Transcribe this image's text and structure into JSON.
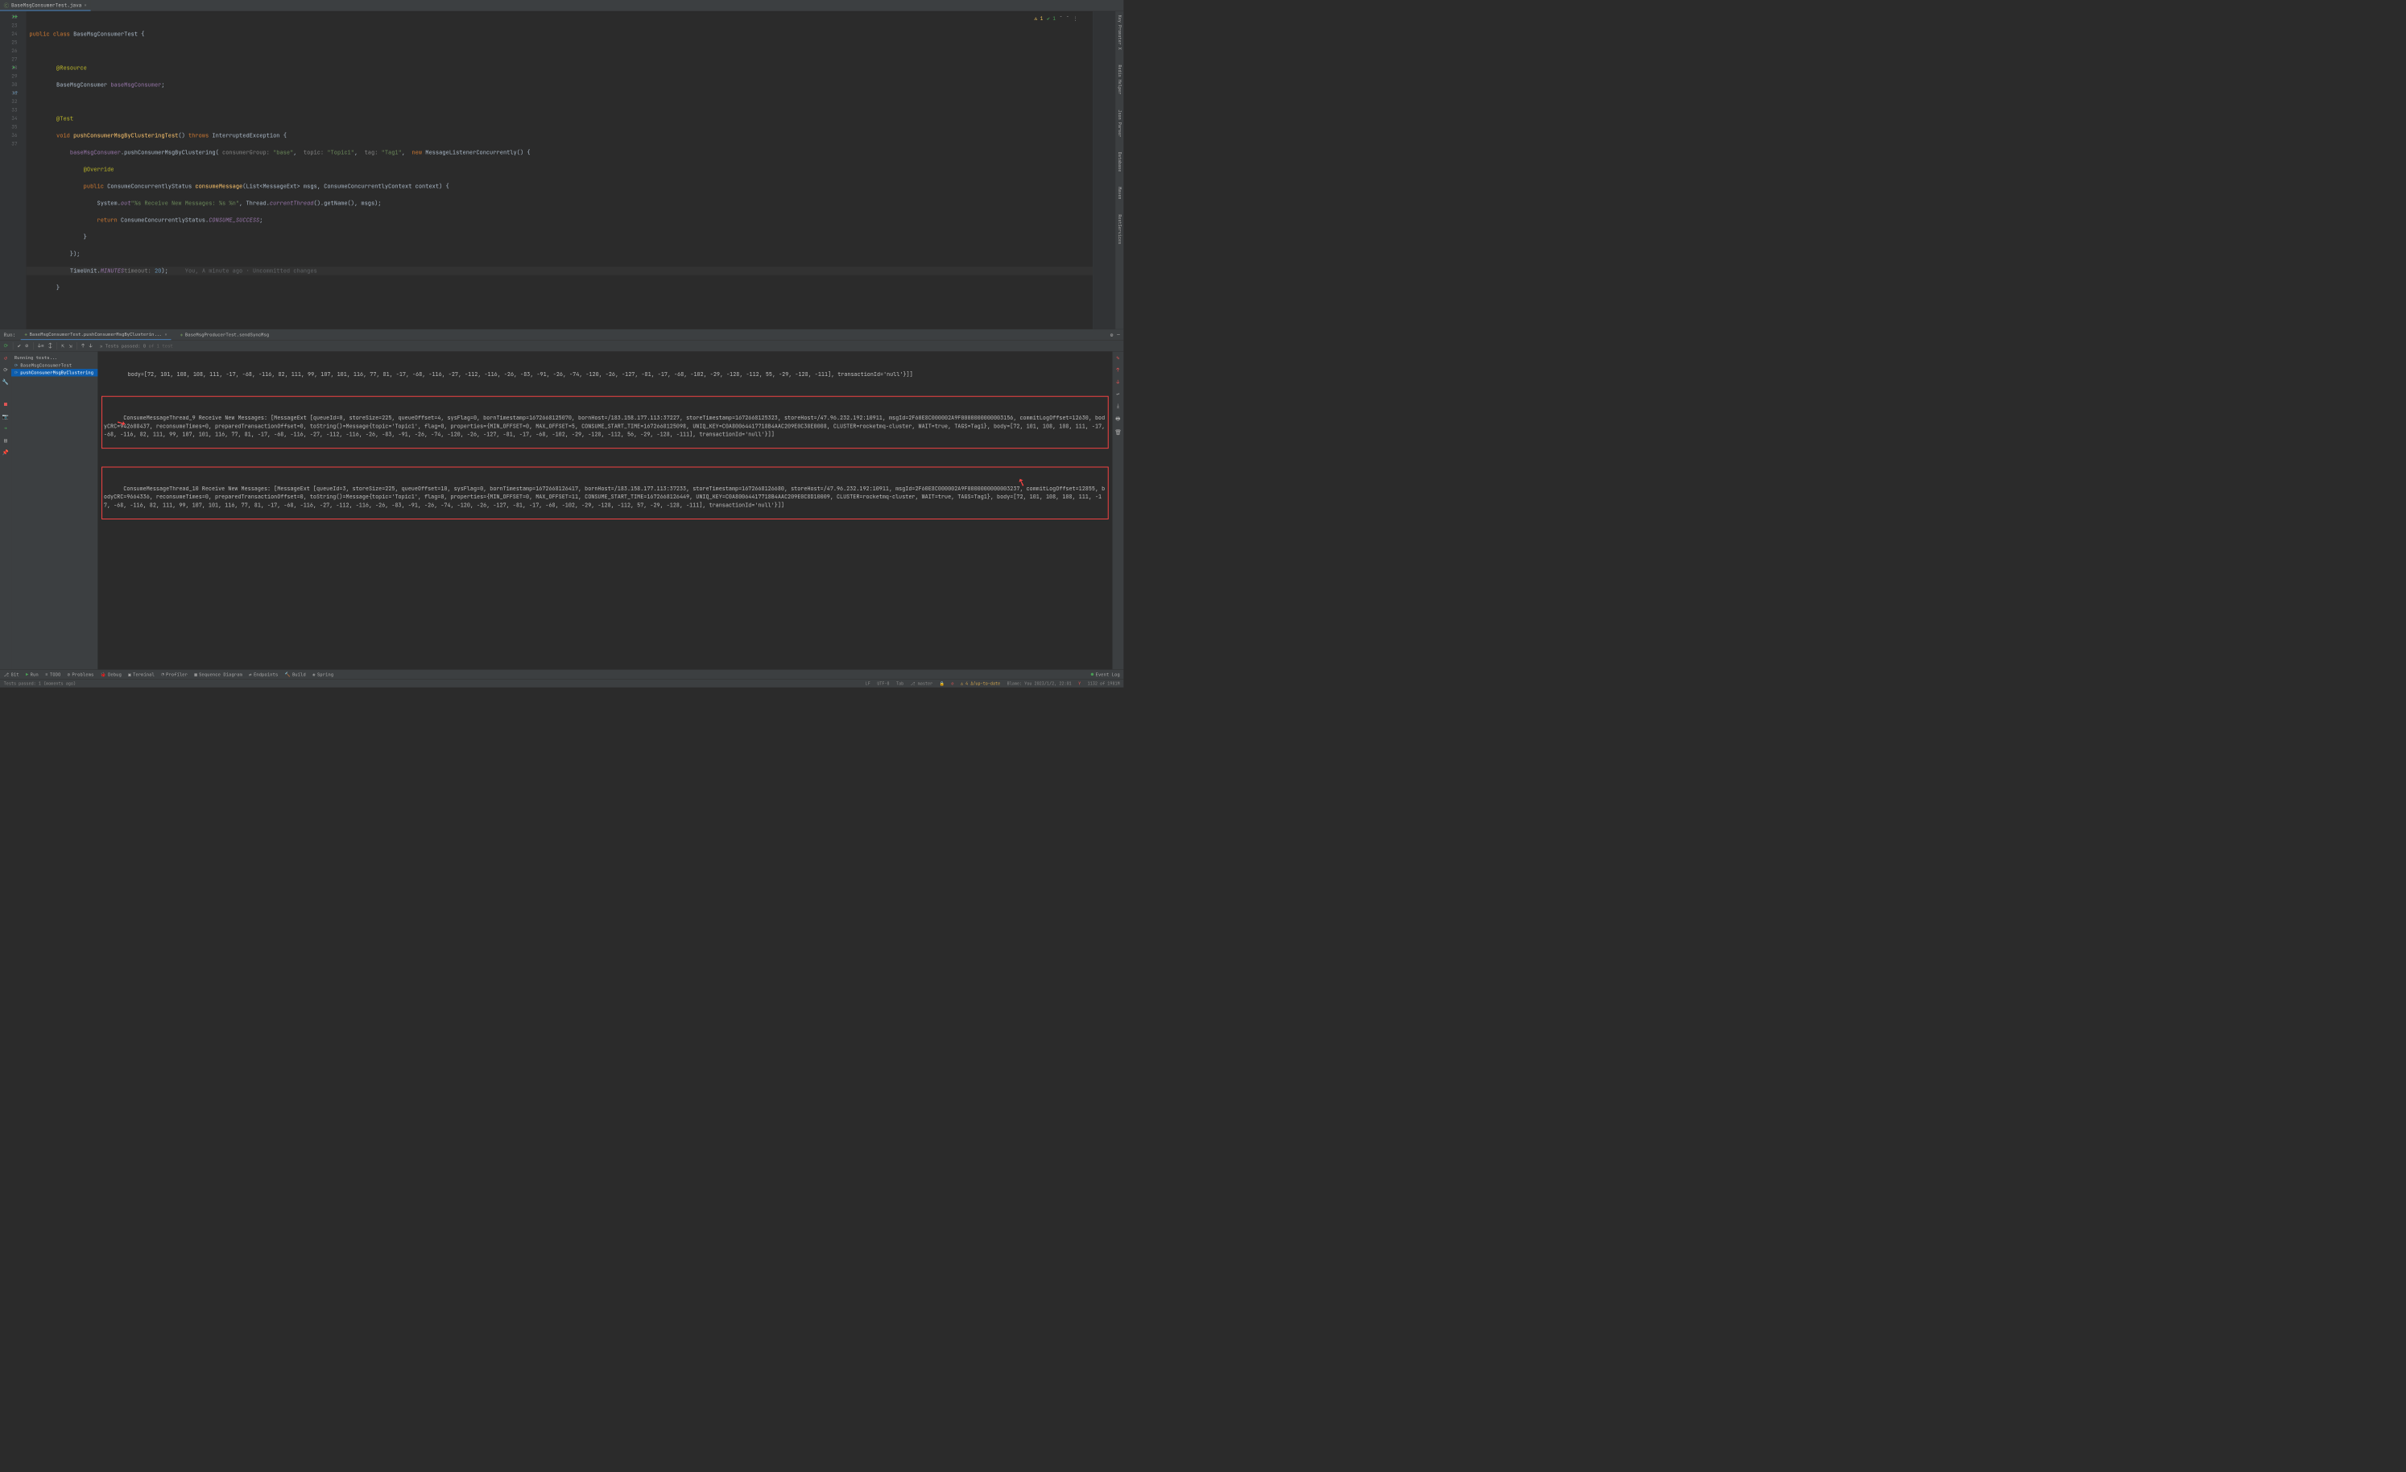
{
  "editorTab": {
    "label": "BaseMsgConsumerTest.java"
  },
  "indicators": {
    "warn": "1",
    "ok": "1"
  },
  "gutter": [
    "22",
    "23",
    "24",
    "25",
    "26",
    "27",
    "28",
    "29",
    "30",
    "31",
    "32",
    "33",
    "34",
    "35",
    "36",
    "37"
  ],
  "code": {
    "l22": {
      "pre": "    ",
      "kw": "public class ",
      "cls": "BaseMsgConsumerTest",
      "post": " {"
    },
    "l24a": "        ",
    "l24ann": "@Resource",
    "l25": {
      "pre": "        ",
      "type": "BaseMsgConsumer ",
      "field": "baseMsgConsumer",
      "post": ";"
    },
    "l27": {
      "pre": "        ",
      "ann": "@Test"
    },
    "l28": {
      "pre": "        ",
      "kw1": "void ",
      "m": "pushConsumerMsgByClusteringTest",
      "paren": "() ",
      "kw2": "throws ",
      "ex": "InterruptedException {",
      "post": ""
    },
    "l29": {
      "pre": "            ",
      "f": "baseMsgConsumer",
      "dot": ".pushConsumerMsgByClustering( ",
      "p1": "consumerGroup: ",
      "s1": "\"base\"",
      "c1": ",  ",
      "p2": "topic: ",
      "s2": "\"Topic1\"",
      "c2": ",  ",
      "p3": "tag: ",
      "s3": "\"Tag1\"",
      "c3": ",  ",
      "kw": "new ",
      "cls": "MessageListenerConcurrently() {"
    },
    "l30": {
      "pre": "                ",
      "ann": "@Override"
    },
    "l31": {
      "pre": "                ",
      "kw": "public ",
      "ret": "ConsumeConcurrentlyStatus ",
      "m": "consumeMessage",
      "op": "(",
      "t1": "List",
      "ang1": "<",
      "t2": "MessageExt",
      "ang2": "> ",
      "a1": "msgs",
      ", ": ", ",
      "t3": "ConsumeConcurrentlyContext ",
      "a2": "context",
      "cp": ") {"
    },
    "l32": {
      "pre": "                    ",
      "sys": "System.",
      "out": "out",
      ".printf": ".printf(",
      "s": "\"%s Receive New Messages: %s %n\"",
      "c": ", Thread.",
      "ct": "currentThread",
      "rest": "().getName(), msgs);"
    },
    "l33": {
      "pre": "                    ",
      "kw": "return ",
      "cls": "ConsumeConcurrentlyStatus.",
      "val": "CONSUME_SUCCESS",
      "sc": ";"
    },
    "l34": "                }",
    "l35": "            });",
    "l36": {
      "pre": "            ",
      "cls": "TimeUnit.",
      "min": "MINUTES",
      ".sleep": ".sleep( ",
      "p": "timeout: ",
      "n": "20",
      "cp": ");",
      "inline": "     You, A minute ago · Uncommitted changes"
    },
    "l37": "        }"
  },
  "runPanel": {
    "label": "Run:",
    "tab1": "BaseMsgConsumerTest.pushConsumerMsgByClusterin...",
    "tab2": "BaseMsgProducerTest.sendSyncMsg",
    "testsPassed": "Tests passed: 0",
    "testsTotal": " of 1 test",
    "running": "Running tests...",
    "treeItem1": "BaseMsgConsumerTest",
    "treeItem2": "pushConsumerMsgByClustering"
  },
  "console": {
    "pre": "        body=[72, 101, 108, 108, 111, -17, -68, -116, 82, 111, 99, 107, 101, 116, 77, 81, -17, -68, -116, -27, -112, -116, -26, -83, -91, -26, -74, -120, -26, -127, -81, -17, -68, -102, -29, -128, -112, 55, -29, -128, -111], transactionId='null'}]]",
    "box1": "ConsumeMessageThread_9 Receive New Messages: [MessageExt [queueId=0, storeSize=225, queueOffset=4, sysFlag=0, bornTimestamp=1672668125070, bornHost=/183.158.177.113:37227, storeTimestamp=1672668125323, storeHost=/47.96.232.192:10911, msgId=2F60E8C000002A9F0000000000003156, commitLogOffset=12630, bodyCRC=942608437, reconsumeTimes=0, preparedTransactionOffset=0, toString()=Message{topic='Topic1', flag=0, properties={MIN_OFFSET=0, MAX_OFFSET=5, CONSUME_START_TIME=1672668125098, UNIQ_KEY=C0A80064417718B4AAC209E0C38E0008, CLUSTER=rocketmq-cluster, WAIT=true, TAGS=Tag1}, body=[72, 101, 108, 108, 111, -17, -68, -116, 82, 111, 99, 107, 101, 116, 77, 81, -17, -68, -116, -27, -112, -116, -26, -83, -91, -26, -74, -120, -26, -127, -81, -17, -68, -102, -29, -128, -112, 56, -29, -128, -111], transactionId='null'}]]",
    "box2": "ConsumeMessageThread_10 Receive New Messages: [MessageExt [queueId=3, storeSize=225, queueOffset=10, sysFlag=0, bornTimestamp=1672668126417, bornHost=/183.158.177.113:37233, storeTimestamp=1672668126680, storeHost=/47.96.232.192:10911, msgId=2F60E8C000002A9F0000000000003237, commitLogOffset=12855, bodyCRC=9664336, reconsumeTimes=0, preparedTransactionOffset=0, toString()=Message{topic='Topic1', flag=0, properties={MIN_OFFSET=0, MAX_OFFSET=11, CONSUME_START_TIME=1672668126449, UNIQ_KEY=C0A80064417718B4AAC209E0C8D10009, CLUSTER=rocketmq-cluster, WAIT=true, TAGS=Tag1}, body=[72, 101, 108, 108, 111, -17, -68, -116, 82, 111, 99, 107, 101, 116, 77, 81, -17, -68, -116, -27, -112, -116, -26, -83, -91, -26, -74, -120, -26, -127, -81, -17, -68, -102, -29, -128, -112, 57, -29, -128, -111], transactionId='null'}]]"
  },
  "bottomTools": {
    "git": "Git",
    "run": "Run",
    "todo": "TODO",
    "problems": "Problems",
    "debug": "Debug",
    "terminal": "Terminal",
    "profiler": "Profiler",
    "seq": "Sequence Diagram",
    "endpoints": "Endpoints",
    "build": "Build",
    "spring": "Spring",
    "eventLog": "Event Log"
  },
  "status": {
    "left": "Tests passed: 1 (moments ago)",
    "lf": "LF",
    "enc": "UTF-8",
    "tab": "Tab",
    "branch": "master",
    "lock": "🔒",
    "arrows": "4 Δ/up-to-date",
    "blame": "Blame: You 2023/1/2, 22:01",
    "mem": "1132 of 1981M"
  },
  "rightTools": [
    "Key Promoter X",
    "Redis Helper",
    "Json Parser",
    "Database",
    "Maven",
    "RestServices"
  ]
}
